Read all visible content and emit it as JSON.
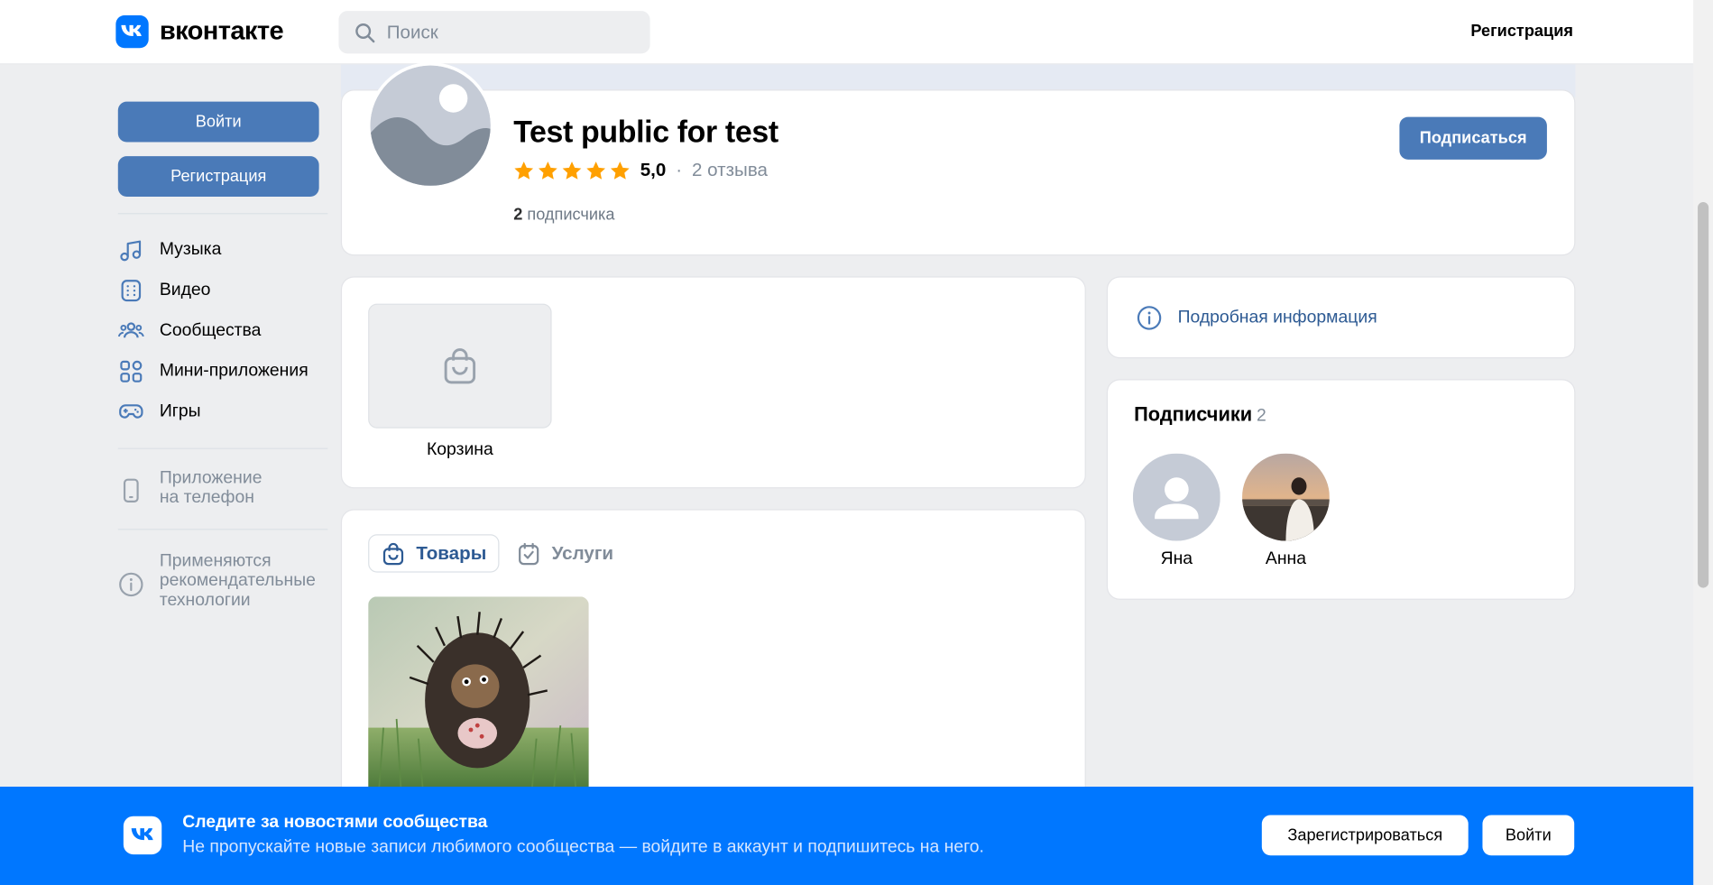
{
  "header": {
    "logo_text": "вконтакте",
    "search_placeholder": "Поиск",
    "register_link": "Регистрация"
  },
  "sidebar": {
    "login_button": "Войти",
    "register_button": "Регистрация",
    "nav": [
      {
        "label": "Музыка",
        "icon": "music-icon"
      },
      {
        "label": "Видео",
        "icon": "video-icon"
      },
      {
        "label": "Сообщества",
        "icon": "communities-icon"
      },
      {
        "label": "Мини-приложения",
        "icon": "mini-apps-icon"
      },
      {
        "label": "Игры",
        "icon": "games-icon"
      }
    ],
    "phone_app": {
      "line1": "Приложение",
      "line2": "на телефон"
    },
    "recommend": {
      "line1": "Применяются",
      "line2": "рекомендательные",
      "line3": "технологии"
    }
  },
  "profile": {
    "name": "Test public for test",
    "rating_stars": 5,
    "rating_score": "5,0",
    "rating_sep": "·",
    "reviews": "2 отзыва",
    "subscribers_count": "2",
    "subscribers_label": "подписчика",
    "subscribe_button": "Подписаться"
  },
  "cart": {
    "label": "Корзина"
  },
  "goods": {
    "tabs": [
      {
        "label": "Товары",
        "active": true
      },
      {
        "label": "Услуги",
        "active": false
      }
    ]
  },
  "info": {
    "label": "Подробная информация"
  },
  "subscribers": {
    "title": "Подписчики",
    "count": "2",
    "members": [
      {
        "name": "Яна"
      },
      {
        "name": "Анна"
      }
    ]
  },
  "banner": {
    "title": "Следите за новостями сообщества",
    "subtitle": "Не пропускайте новые записи любимого сообщества — войдите в аккаунт и подпишитесь на него.",
    "register_button": "Зарегистрироваться",
    "login_button": "Войти"
  },
  "colors": {
    "accent": "#0077ff",
    "button": "#4a7ab8",
    "link": "#2d5a93",
    "star": "#ffa000"
  }
}
